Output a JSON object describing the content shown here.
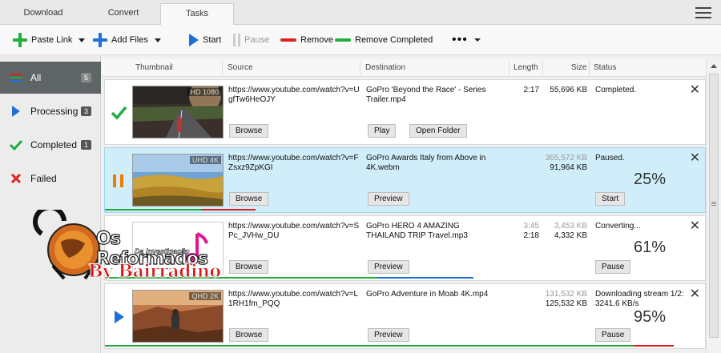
{
  "tabs": [
    {
      "label": "Download"
    },
    {
      "label": "Convert"
    },
    {
      "label": "Tasks"
    }
  ],
  "toolbar": {
    "paste_link": "Paste Link",
    "add_files": "Add Files",
    "start": "Start",
    "pause": "Pause",
    "remove": "Remove",
    "remove_completed": "Remove Completed",
    "more": "•••"
  },
  "sidebar": {
    "items": [
      {
        "label": "All",
        "count": "5",
        "icon": "all-lines-icon"
      },
      {
        "label": "Processing",
        "count": "3",
        "icon": "play-icon"
      },
      {
        "label": "Completed",
        "count": "1",
        "icon": "check-icon"
      },
      {
        "label": "Failed",
        "icon": "x-icon"
      }
    ]
  },
  "columns": {
    "thumbnail": "Thumbnail",
    "source": "Source",
    "destination": "Destination",
    "length": "Length",
    "size": "Size",
    "status": "Status"
  },
  "rows": [
    {
      "badge": "HD 1080",
      "source": "https://www.youtube.com/watch?v=UgfTw6HeOJY",
      "destination": "GoPro  'Beyond the Race' - Series Trailer.mp4",
      "length": "2:17",
      "size": "55,696 KB",
      "status": "Completed.",
      "buttons": {
        "left": "Browse",
        "mid1": "Play",
        "mid2": "Open Folder"
      }
    },
    {
      "badge": "UHD 4K",
      "source": "https://www.youtube.com/watch?v=FZsxz9ZpKGI",
      "destination": "GoPro Awards  Italy from Above in 4K.webm",
      "size_top": "365,572 KB",
      "size": "91,964 KB",
      "status": "Paused.",
      "percent": "25%",
      "progress": 0.25,
      "buttons": {
        "left": "Browse",
        "mid1": "Preview",
        "action": "Start"
      }
    },
    {
      "source": "https://www.youtube.com/watch?v=SPc_JVHw_DU",
      "destination": "GoPro HERO 4  AMAZING THAILAND TRIP  Travel.mp3",
      "length_top": "3:45",
      "length": "2:18",
      "size_top": "3,453 KB",
      "size": "4,332 KB",
      "status": "Converting...",
      "percent": "61%",
      "progress": 0.61,
      "buttons": {
        "left": "Browse",
        "mid1": "Preview",
        "action": "Pause"
      }
    },
    {
      "badge": "QHD 2K",
      "source": "https://www.youtube.com/watch?v=L1RH1fm_PQQ",
      "destination": "GoPro  Adventure in Moab 4K.mp4",
      "size_top": "131,532 KB",
      "size": "125,532 KB",
      "status": "Downloading stream 1/2: 3241.6 KB/s",
      "percent": "95%",
      "progress": 0.95,
      "buttons": {
        "left": "Browse",
        "mid1": "Preview",
        "action": "Pause"
      }
    }
  ],
  "watermark": {
    "line1": "Os Reformados",
    "line2": "Da Investigação",
    "line3": "By Bairradino"
  },
  "colors": {
    "green": "#1fae3f",
    "blue": "#1f6fd6",
    "red": "#e02020",
    "orange": "#f07d00",
    "selected_row": "#cfeefa"
  }
}
